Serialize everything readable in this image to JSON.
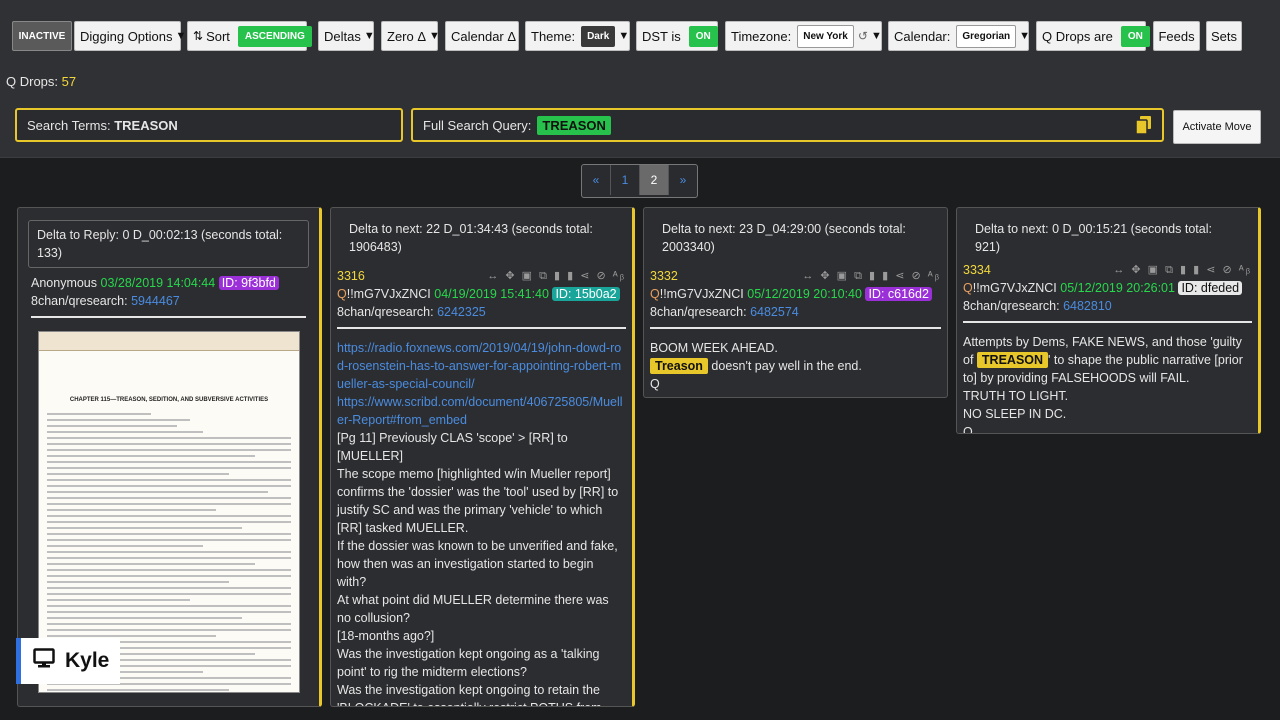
{
  "toolbar": {
    "inactive": "INACTIVE",
    "digging": "Digging Options",
    "sort_label": "Sort",
    "sort_value": "ASCENDING",
    "deltas": "Deltas",
    "zero": "Zero Δ",
    "calendar_delta": "Calendar Δ",
    "theme_label": "Theme:",
    "theme_value": "Dark",
    "dst_label": "DST is",
    "dst_value": "ON",
    "tz_label": "Timezone:",
    "tz_value": "New York",
    "calendar_label": "Calendar:",
    "calendar_value": "Gregorian",
    "qdrops_label": "Q Drops are",
    "qdrops_value": "ON",
    "feeds": "Feeds",
    "sets": "Sets"
  },
  "status": {
    "qdrops_label": "Q Drops:",
    "qdrops_count": "57"
  },
  "search": {
    "terms_label": "Search Terms:",
    "terms_value": "TREASON",
    "full_label": "Full Search Query:",
    "full_value": "TREASON",
    "activate": "Activate Move"
  },
  "pager": {
    "prev": "«",
    "p1": "1",
    "p2": "2",
    "next": "»"
  },
  "cards": [
    {
      "delta": "Delta to Reply: 0 D_00:02:13 (seconds total: 133)",
      "author": "Anonymous",
      "date": "03/28/2019 14:04:44",
      "id": "ID: 9f3bfd",
      "board": "8chan/qresearch:",
      "post": "5944467",
      "doc_title": "CHAPTER 115—TREASON, SEDITION, AND SUBVERSIVE ACTIVITIES"
    },
    {
      "delta": "Delta to next: 22 D_01:34:43 (seconds total: 1906483)",
      "num": "3316",
      "trip": "!!mG7VJxZNCI",
      "date": "04/19/2019 15:41:40",
      "id": "ID: 15b0a2",
      "board": "8chan/qresearch:",
      "post": "6242325",
      "link1": "https://radio.foxnews.com/2019/04/19/john-dowd-rod-rosenstein-has-to-answer-for-appointing-robert-mueller-as-special-council/",
      "link2": "https://www.scribd.com/document/406725805/Mueller-Report#from_embed",
      "lines": [
        "[Pg 11] Previously CLAS 'scope' > [RR] to [MUELLER]",
        "The scope memo [highlighted w/in Mueller report] confirms the 'dossier' was the 'tool' used by [RR] to justify SC and was the primary 'vehicle' to which [RR] tasked MUELLER.",
        "If the dossier was known to be unverified and fake, how then was an investigation started to begin with?",
        "At what point did MUELLER determine there was no collusion?",
        "[18-months ago?]",
        "Was the investigation kept ongoing as a 'talking point' to rig the midterm elections?",
        "Was the investigation kept ongoing to retain the 'BLOCKADE' to essentially restrict POTUS from"
      ]
    },
    {
      "delta": "Delta to next: 23 D_04:29:00 (seconds total: 2003340)",
      "num": "3332",
      "trip": "!!mG7VJxZNCI",
      "date": "05/12/2019 20:10:40",
      "id": "ID: c616d2",
      "board": "8chan/qresearch:",
      "post": "6482574",
      "line1": "BOOM WEEK AHEAD.",
      "tag": "Treason",
      "line2": "doesn't pay well in the end.",
      "sign": "Q"
    },
    {
      "delta": "Delta to next: 0 D_00:15:21 (seconds total: 921)",
      "num": "3334",
      "trip": "!!mG7VJxZNCI",
      "date": "05/12/2019 20:26:01",
      "id": "ID: dfeded",
      "board": "8chan/qresearch:",
      "post": "6482810",
      "pre": "Attempts by Dems, FAKE NEWS, and those 'guilty of",
      "tag": "TREASON",
      "post_text": "' to shape the public narrative [prior to] by providing FALSEHOODS will FAIL.",
      "l2": "TRUTH TO LIGHT.",
      "l3": "NO SLEEP IN DC.",
      "sign": "Q"
    }
  ],
  "overlay": {
    "name": "Kyle"
  },
  "icons": {
    "copy": "copy-icon",
    "monitor": "monitor-icon",
    "sort": "sort-icon",
    "reset": "reset-icon"
  }
}
